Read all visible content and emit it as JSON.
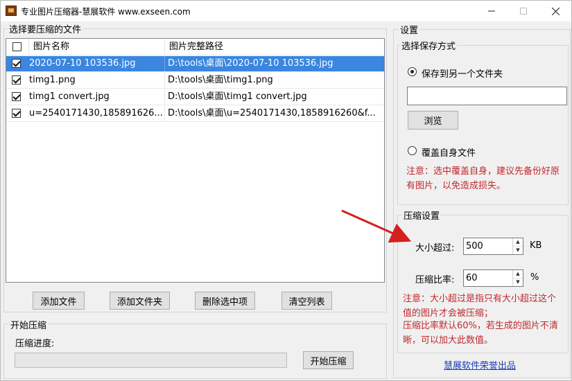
{
  "window": {
    "title": "专业图片压缩器-慧展软件 www.exseen.com",
    "min_icon": "minimize-icon",
    "max_icon": "maximize-icon",
    "close_icon": "close-icon"
  },
  "files": {
    "group_label": "选择要压缩的文件",
    "columns": [
      "图片名称",
      "图片完整路径"
    ],
    "rows": [
      {
        "checked": true,
        "name": "2020-07-10 103536.jpg",
        "path": "D:\\tools\\桌面\\2020-07-10 103536.jpg",
        "selected": true
      },
      {
        "checked": true,
        "name": "timg1.png",
        "path": "D:\\tools\\桌面\\timg1.png",
        "selected": false
      },
      {
        "checked": true,
        "name": "timg1 convert.jpg",
        "path": "D:\\tools\\桌面\\timg1 convert.jpg",
        "selected": false
      },
      {
        "checked": true,
        "name": "u=2540171430,185891626...",
        "path": "D:\\tools\\桌面\\u=2540171430,1858916260&f...",
        "selected": false
      }
    ],
    "buttons": {
      "add_file": "添加文件",
      "add_folder": "添加文件夹",
      "delete_selected": "删除选中项",
      "clear_list": "清空列表"
    }
  },
  "compress": {
    "group_label": "开始压缩",
    "progress_label": "压缩进度:",
    "progress_value": 0,
    "start_button": "开始压缩"
  },
  "settings": {
    "group_label": "设置",
    "save_mode_label": "选择保存方式",
    "save_to_folder": "保存到另一个文件夹",
    "folder_value": "",
    "browse": "浏览",
    "overwrite": "覆盖自身文件",
    "save_note": "注意：选中覆盖自身，建议先备份好原有图片，以免造成损失。",
    "compress_settings_label": "压缩设置",
    "size_label": "大小超过:",
    "size_value": "500",
    "size_unit": "KB",
    "ratio_label": "压缩比率:",
    "ratio_value": "60",
    "ratio_unit": "%",
    "compress_note_1": "注意：大小超过是指只有大小超过这个值的图片才会被压缩；",
    "compress_note_2": "压缩比率默认60%，若生成的图片不清晰，可以加大此数值。",
    "credit": "慧展软件荣誉出品"
  },
  "colors": {
    "selection": "#3a86e0",
    "note_red": "#c0282d",
    "link_blue": "#1a3bb5",
    "arrow_red": "#d42020"
  }
}
